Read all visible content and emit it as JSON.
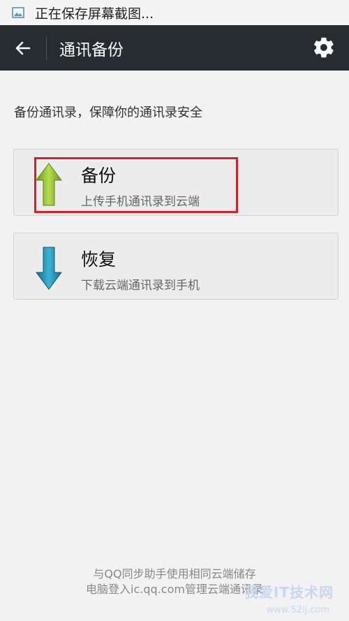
{
  "status_bar": {
    "text": "正在保存屏幕截图..."
  },
  "app_bar": {
    "title": "通讯备份"
  },
  "intro_text": "备份通讯录，保障你的通讯录安全",
  "backup_card": {
    "title": "备份",
    "subtitle": "上传手机通讯录到云端"
  },
  "restore_card": {
    "title": "恢复",
    "subtitle": "下载云端通讯录到手机"
  },
  "footer": {
    "line1": "与QQ同步助手使用相同云端储存",
    "line2": "电脑登入ic.qq.com管理云端通讯录"
  },
  "watermark": {
    "text": "我爱IT技术网",
    "url": "www.52ij.com"
  },
  "colors": {
    "appbar": "#272c30",
    "highlight": "#d3202a",
    "up_arrow": "#8dbb2a",
    "down_arrow": "#1f8fb0"
  }
}
